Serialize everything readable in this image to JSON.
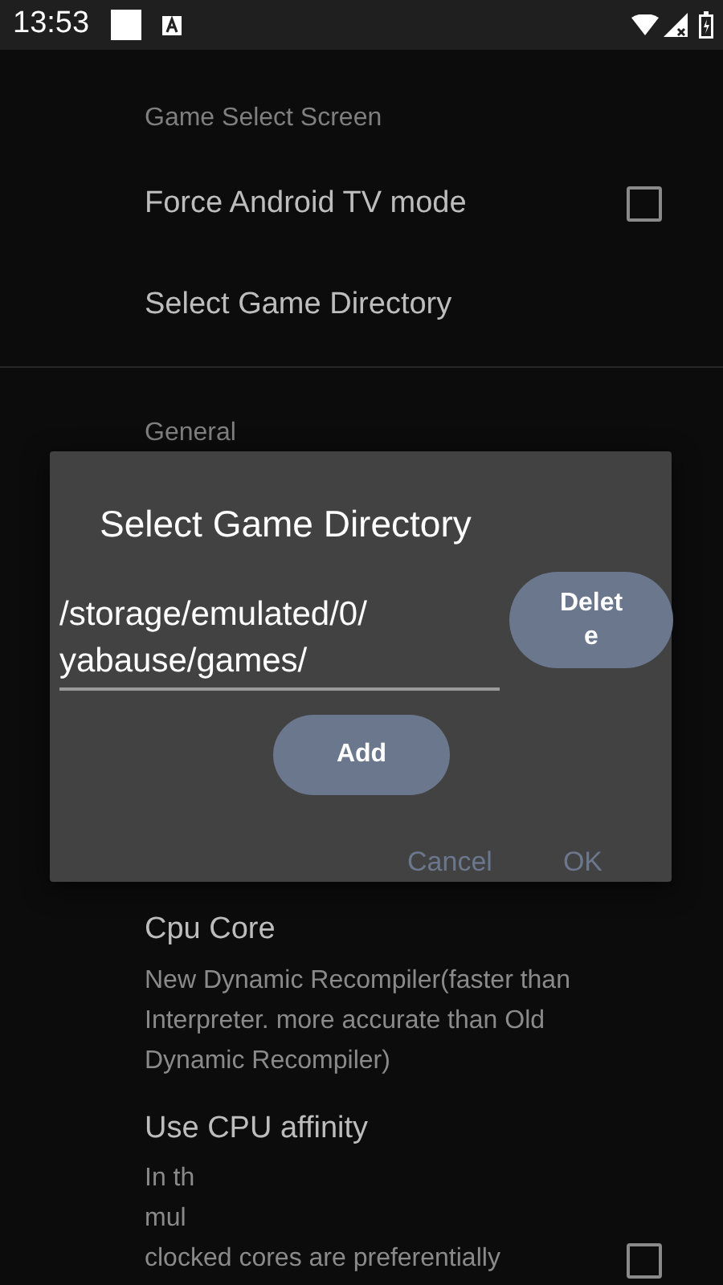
{
  "status_bar": {
    "time": "13:53"
  },
  "sections": [
    {
      "title": "Game Select Screen",
      "items": [
        {
          "kind": "checkbox",
          "title": "Force Android TV mode",
          "checked": false
        },
        {
          "kind": "plain",
          "title": "Select Game Directory"
        }
      ]
    },
    {
      "title": "General",
      "items": [
        {
          "kind": "plain",
          "title": "Cpu Core",
          "summary": [
            "New Dynamic Recompiler(faster than",
            "Interpreter. more accurate than Old",
            "Dynamic Recompiler)"
          ]
        },
        {
          "kind": "checkbox",
          "title": "Use CPU affinity",
          "summary": [
            "In th",
            "mul",
            "clocked cores are preferentially"
          ],
          "checked": false
        }
      ]
    }
  ],
  "dialog": {
    "title": "Select Game Directory",
    "directories": [
      {
        "path": "/storage/emulated/0/\nyabause/games/",
        "delete_label": "Delet\ne"
      }
    ],
    "add_label": "Add",
    "buttons": [
      "Cancel",
      "OK"
    ]
  }
}
